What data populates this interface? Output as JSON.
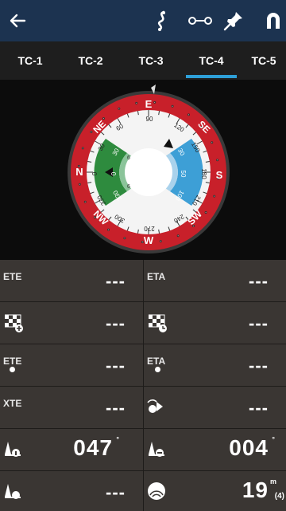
{
  "tabs": [
    {
      "label": "TC-1"
    },
    {
      "label": "TC-2"
    },
    {
      "label": "TC-3"
    },
    {
      "label": "TC-4"
    },
    {
      "label": "TC-5"
    }
  ],
  "active_tab": "TC-4",
  "compass": {
    "cardinals": {
      "e": "E",
      "se": "SE",
      "s": "S",
      "sw": "SW",
      "w": "W",
      "nw": "NW",
      "n": "N",
      "ne": "NE"
    },
    "bearings": [
      "90",
      "120",
      "150",
      "180",
      "210",
      "240",
      "270",
      "300",
      "330",
      "0",
      "30",
      "60"
    ],
    "left_scale": [
      "30",
      "0",
      "330"
    ],
    "right_scale": [
      "30",
      "50",
      "100"
    ],
    "small_marks": [
      "6",
      "6"
    ]
  },
  "grid": {
    "ete_label": "ETE",
    "ete_value": "---",
    "eta_label": "ETA",
    "eta_value": "---",
    "r2_left_value": "---",
    "r2_right_value": "---",
    "ete_wp_label": "ETE",
    "ete_wp_value": "---",
    "eta_wp_label": "ETA",
    "eta_wp_value": "---",
    "xte_label": "XTE",
    "xte_value": "---",
    "r4_right_value": "---",
    "r5_left_value": "047",
    "r5_left_unit": "°",
    "r5_right_value": "004",
    "r5_right_unit": "°",
    "r6_left_value": "---",
    "r6_right_value": "19",
    "r6_right_unit": "m",
    "r6_right_sub": "(4)"
  },
  "colors": {
    "topbar": "#1c3350",
    "accent": "#2ea0d8",
    "ring": "#c8202a",
    "green": "#2e8b3e",
    "blue": "#3d9fd6"
  }
}
